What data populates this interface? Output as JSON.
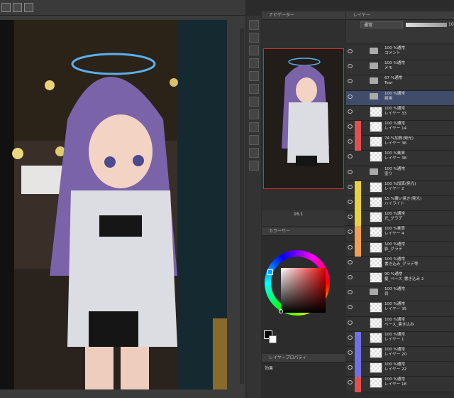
{
  "navigator": {
    "title": "ナビゲーター",
    "zoom": "16.1"
  },
  "color_panel": {
    "title": "カラーサー"
  },
  "props_panel": {
    "title": "レイヤープロパティ",
    "effect_label": "効果"
  },
  "layer_panel": {
    "title": "レイヤー",
    "blend_mode": "通常",
    "opacity": "10"
  },
  "layers": [
    {
      "mode": "100 %通常",
      "name": "コメント",
      "kind": "folder",
      "color": "",
      "selected": false
    },
    {
      "mode": "100 %通常",
      "name": "メモ",
      "kind": "folder",
      "color": "",
      "selected": false
    },
    {
      "mode": "67 %通常",
      "name": "Tear",
      "kind": "folder",
      "color": "",
      "selected": false
    },
    {
      "mode": "100 %通常",
      "name": "線画",
      "kind": "folder",
      "color": "",
      "selected": true
    },
    {
      "mode": "100 %通常",
      "name": "レイヤー 33",
      "kind": "layer",
      "color": "",
      "selected": false
    },
    {
      "mode": "100 %通常",
      "name": "レイヤー 14",
      "kind": "layer",
      "color": "#e05050",
      "selected": false
    },
    {
      "mode": "74 %加算(発光)",
      "name": "レイヤー 36",
      "kind": "layer",
      "color": "#e05050",
      "selected": false
    },
    {
      "mode": "100 %乗算",
      "name": "レイヤー 38",
      "kind": "layer",
      "color": "",
      "selected": false
    },
    {
      "mode": "100 %通常",
      "name": "塗り",
      "kind": "folder",
      "color": "",
      "selected": false
    },
    {
      "mode": "100 %加算(発光)",
      "name": "レイヤー 2",
      "kind": "layer",
      "color": "#e8d23c",
      "selected": false
    },
    {
      "mode": "15 %覆い焼き(発光)",
      "name": "ハイライト",
      "kind": "layer",
      "color": "#e8d23c",
      "selected": false
    },
    {
      "mode": "100 %通常",
      "name": "光_グラデ",
      "kind": "layer",
      "color": "#e8d23c",
      "selected": false
    },
    {
      "mode": "100 %乗算",
      "name": "レイヤー 4",
      "kind": "layer",
      "color": "#f0a050",
      "selected": false
    },
    {
      "mode": "100 %通常",
      "name": "影_グラデ",
      "kind": "layer",
      "color": "#f0a050",
      "selected": false
    },
    {
      "mode": "100 %通常",
      "name": "書き込み_グラデ等",
      "kind": "layer",
      "color": "",
      "selected": false
    },
    {
      "mode": "90 %通常",
      "name": "髪_ベース_書き込み 2",
      "kind": "layer",
      "color": "",
      "selected": false
    },
    {
      "mode": "100 %通常",
      "name": "目",
      "kind": "folder",
      "color": "",
      "selected": false
    },
    {
      "mode": "100 %通常",
      "name": "レイヤー 35",
      "kind": "layer",
      "color": "",
      "selected": false
    },
    {
      "mode": "100 %通常",
      "name": "ベース_書き込み",
      "kind": "layer",
      "color": "",
      "selected": false
    },
    {
      "mode": "100 %通常",
      "name": "レイヤー 1",
      "kind": "layer",
      "color": "#7070e0",
      "selected": false
    },
    {
      "mode": "100 %通常",
      "name": "レイヤー 20",
      "kind": "layer",
      "color": "#7070e0",
      "selected": false
    },
    {
      "mode": "100 %通常",
      "name": "レイヤー 22",
      "kind": "layer",
      "color": "#7070e0",
      "selected": false
    },
    {
      "mode": "100 %通常",
      "name": "レイヤー 18",
      "kind": "layer",
      "color": "#e05050",
      "selected": false
    }
  ]
}
